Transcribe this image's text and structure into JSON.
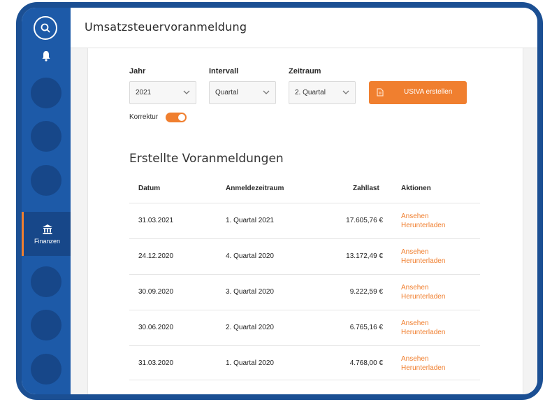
{
  "app": {
    "page_title": "Umsatzsteuervoranmeldung"
  },
  "sidebar": {
    "active_item": {
      "label": "Finanzen",
      "icon": "bank-icon"
    },
    "accent_color": "#f07f2f"
  },
  "form": {
    "year": {
      "label": "Jahr",
      "value": "2021"
    },
    "interval": {
      "label": "Intervall",
      "value": "Quartal"
    },
    "period": {
      "label": "Zeitraum",
      "value": "2. Quartal"
    },
    "create_button": "UStVA erstellen",
    "correction": {
      "label": "Korrektur",
      "enabled": true
    }
  },
  "table": {
    "title": "Erstellte Voranmeldungen",
    "headers": {
      "date": "Datum",
      "period": "Anmeldezeitraum",
      "amount": "Zahllast",
      "actions": "Aktionen"
    },
    "rows": [
      {
        "date": "31.03.2021",
        "period": "1. Quartal 2021",
        "amount": "17.605,76 €",
        "view": "Ansehen",
        "download": "Herunterladen"
      },
      {
        "date": "24.12.2020",
        "period": "4. Quartal 2020",
        "amount": "13.172,49 €",
        "view": "Ansehen",
        "download": "Herunterladen"
      },
      {
        "date": "30.09.2020",
        "period": "3. Quartal 2020",
        "amount": "9.222,59 €",
        "view": "Ansehen",
        "download": "Herunterladen"
      },
      {
        "date": "30.06.2020",
        "period": "2. Quartal 2020",
        "amount": "6.765,16 €",
        "view": "Ansehen",
        "download": "Herunterladen"
      },
      {
        "date": "31.03.2020",
        "period": "1. Quartal 2020",
        "amount": "4.768,00 €",
        "view": "Ansehen",
        "download": "Herunterladen"
      }
    ]
  }
}
